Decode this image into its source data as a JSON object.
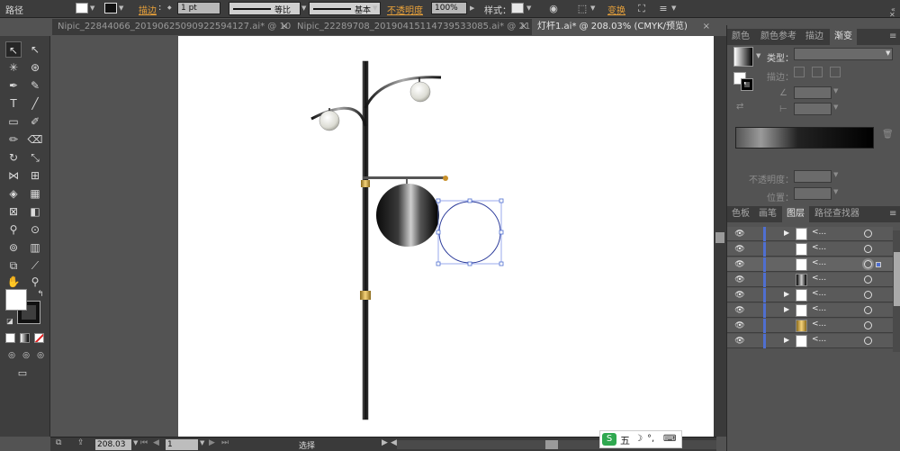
{
  "control_bar": {
    "path_label": "路径",
    "stroke_link": "描边",
    "stroke_weight": "1 pt",
    "profile_1": "等比",
    "profile_2": "基本",
    "opacity_link": "不透明度",
    "opacity_value": "100%",
    "style_label": "样式：",
    "transform_link": "变换"
  },
  "tabs": [
    {
      "label": "Nipic_22844066_20190625090922594127.ai* @ 10...",
      "close": "×"
    },
    {
      "label": "Nipic_22289708_20190415114739533085.ai* @ 21...",
      "close": "×"
    },
    {
      "label": "灯杆1.ai* @ 208.03% (CMYK/预览)",
      "close": "×"
    }
  ],
  "status": {
    "zoom": "208.03",
    "page": "1",
    "tool": "选择"
  },
  "ime": {
    "label": "五"
  },
  "panel_top": {
    "tabs": [
      "颜色",
      "颜色参考",
      "描边",
      "渐变"
    ],
    "type_label": "类型：",
    "stroke_label": "描边：",
    "opacity_label": "不透明度：",
    "position_label": "位置："
  },
  "panel_layers": {
    "tabs": [
      "色板",
      "画笔",
      "图层",
      "路径查找器"
    ],
    "rows": [
      {
        "name": "<...",
        "expandable": true,
        "selected": false
      },
      {
        "name": "<...",
        "expandable": false,
        "selected": false
      },
      {
        "name": "<...",
        "expandable": false,
        "selected": true
      },
      {
        "name": "<...",
        "expandable": false,
        "selected": false
      },
      {
        "name": "<...",
        "expandable": true,
        "selected": false
      },
      {
        "name": "<...",
        "expandable": true,
        "selected": false
      },
      {
        "name": "<...",
        "expandable": false,
        "selected": false
      },
      {
        "name": "<...",
        "expandable": true,
        "selected": false
      }
    ]
  },
  "colors": {
    "ui_dark": "#3c3c3c",
    "ui_mid": "#535353",
    "accent_link": "#e8a13a",
    "selection_blue": "#4f6fd0",
    "artboard": "#ffffff"
  }
}
